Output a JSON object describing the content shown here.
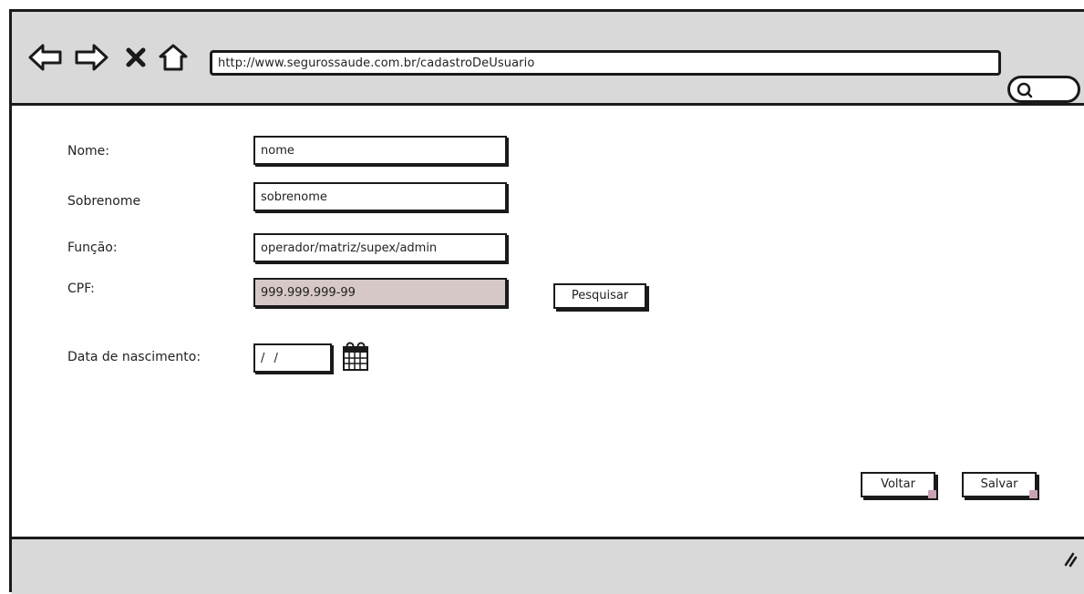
{
  "browser": {
    "url": "http://www.segurossaude.com.br/cadastroDeUsuario"
  },
  "form": {
    "nome": {
      "label": "Nome:",
      "value": "nome"
    },
    "sobrenome": {
      "label": "Sobrenome",
      "value": "sobrenome"
    },
    "funcao": {
      "label": "Função:",
      "value": "operador/matriz/supex/admin"
    },
    "cpf": {
      "label": "CPF:",
      "value": "999.999.999-99"
    },
    "nascimento": {
      "label": "Data de nascimento:",
      "value": "/ /"
    }
  },
  "buttons": {
    "pesquisar": "Pesquisar",
    "voltar": "Voltar",
    "salvar": "Salvar"
  },
  "colors": {
    "chrome": "#d9d9d9",
    "disabled_field": "#d6c8c6",
    "accent_corner": "#c9a3b5"
  }
}
